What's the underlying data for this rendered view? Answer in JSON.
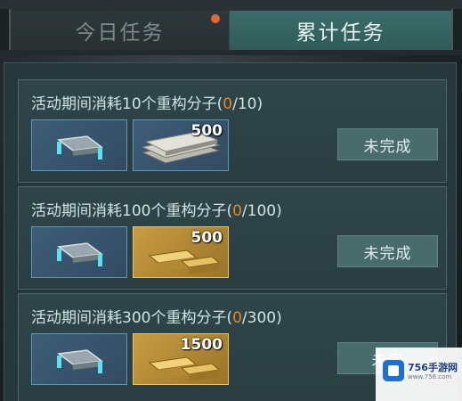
{
  "tabs": [
    {
      "label": "今日任务",
      "active": false,
      "has_notification": true
    },
    {
      "label": "累计任务",
      "active": true
    }
  ],
  "quests": [
    {
      "title_prefix": "活动期间消耗10个重构分子(",
      "progress_current": "0",
      "title_suffix": "/10)",
      "rewards": [
        {
          "icon": "component-part-icon",
          "count": ""
        },
        {
          "icon": "cash-stack-icon",
          "count": "500"
        }
      ],
      "status": "未完成"
    },
    {
      "title_prefix": "活动期间消耗100个重构分子(",
      "progress_current": "0",
      "title_suffix": "/100)",
      "rewards": [
        {
          "icon": "component-part-icon",
          "count": ""
        },
        {
          "icon": "gold-bars-icon",
          "count": "500"
        }
      ],
      "status": "未完成"
    },
    {
      "title_prefix": "活动期间消耗300个重构分子(",
      "progress_current": "0",
      "title_suffix": "/300)",
      "rewards": [
        {
          "icon": "component-part-icon",
          "count": ""
        },
        {
          "icon": "gold-bars-icon",
          "count": "1500"
        }
      ],
      "status": "未完"
    }
  ],
  "watermark": {
    "brand": "756手游网",
    "sub": "www.756.com"
  },
  "colors": {
    "active_tab": "#3c6d6a",
    "progress": "#e4872c",
    "reward_frame_blue": "#5e97b6",
    "reward_frame_gold": "#e9c46a",
    "notification_dot": "#e06a35"
  }
}
